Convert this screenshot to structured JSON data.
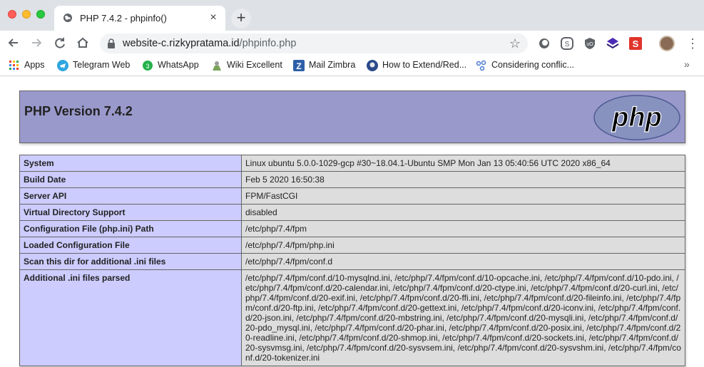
{
  "browser": {
    "tab_title": "PHP 7.4.2 - phpinfo()",
    "tab_close": "×",
    "new_tab": "+",
    "url_host": "website-c.rizkypratama.id",
    "url_path": "/phpinfo.php",
    "star": "☆",
    "menu": "⋮"
  },
  "bookmarks": {
    "items": [
      {
        "label": "Apps",
        "icon": "apps-grid-icon"
      },
      {
        "label": "Telegram Web",
        "icon": "telegram-icon"
      },
      {
        "label": "WhatsApp",
        "icon": "whatsapp-icon"
      },
      {
        "label": "Wiki Excellent",
        "icon": "wiki-icon"
      },
      {
        "label": "Mail Zimbra",
        "icon": "zimbra-icon"
      },
      {
        "label": "How to Extend/Red...",
        "icon": "github-icon"
      },
      {
        "label": "Considering conflic...",
        "icon": "link-icon"
      }
    ],
    "more": "»"
  },
  "phpinfo": {
    "version_title": "PHP Version 7.4.2",
    "logo_text": "php",
    "rows": [
      {
        "key": "System",
        "value": "Linux ubuntu 5.0.0-1029-gcp #30~18.04.1-Ubuntu SMP Mon Jan 13 05:40:56 UTC 2020 x86_64"
      },
      {
        "key": "Build Date",
        "value": "Feb 5 2020 16:50:38"
      },
      {
        "key": "Server API",
        "value": "FPM/FastCGI"
      },
      {
        "key": "Virtual Directory Support",
        "value": "disabled"
      },
      {
        "key": "Configuration File (php.ini) Path",
        "value": "/etc/php/7.4/fpm"
      },
      {
        "key": "Loaded Configuration File",
        "value": "/etc/php/7.4/fpm/php.ini"
      },
      {
        "key": "Scan this dir for additional .ini files",
        "value": "/etc/php/7.4/fpm/conf.d"
      },
      {
        "key": "Additional .ini files parsed",
        "value": "/etc/php/7.4/fpm/conf.d/10-mysqlnd.ini, /etc/php/7.4/fpm/conf.d/10-opcache.ini, /etc/php/7.4/fpm/conf.d/10-pdo.ini, /etc/php/7.4/fpm/conf.d/20-calendar.ini, /etc/php/7.4/fpm/conf.d/20-ctype.ini, /etc/php/7.4/fpm/conf.d/20-curl.ini, /etc/php/7.4/fpm/conf.d/20-exif.ini, /etc/php/7.4/fpm/conf.d/20-ffi.ini, /etc/php/7.4/fpm/conf.d/20-fileinfo.ini, /etc/php/7.4/fpm/conf.d/20-ftp.ini, /etc/php/7.4/fpm/conf.d/20-gettext.ini, /etc/php/7.4/fpm/conf.d/20-iconv.ini, /etc/php/7.4/fpm/conf.d/20-json.ini, /etc/php/7.4/fpm/conf.d/20-mbstring.ini, /etc/php/7.4/fpm/conf.d/20-mysqli.ini, /etc/php/7.4/fpm/conf.d/20-pdo_mysql.ini, /etc/php/7.4/fpm/conf.d/20-phar.ini, /etc/php/7.4/fpm/conf.d/20-posix.ini, /etc/php/7.4/fpm/conf.d/20-readline.ini, /etc/php/7.4/fpm/conf.d/20-shmop.ini, /etc/php/7.4/fpm/conf.d/20-sockets.ini, /etc/php/7.4/fpm/conf.d/20-sysvmsg.ini, /etc/php/7.4/fpm/conf.d/20-sysvsem.ini, /etc/php/7.4/fpm/conf.d/20-sysvshm.ini, /etc/php/7.4/fpm/conf.d/20-tokenizer.ini"
      }
    ]
  },
  "colors": {
    "header_bg": "#9999cc",
    "key_cell_bg": "#ccccff",
    "value_cell_bg": "#dddddd",
    "logo_bg": "#8892bf"
  }
}
